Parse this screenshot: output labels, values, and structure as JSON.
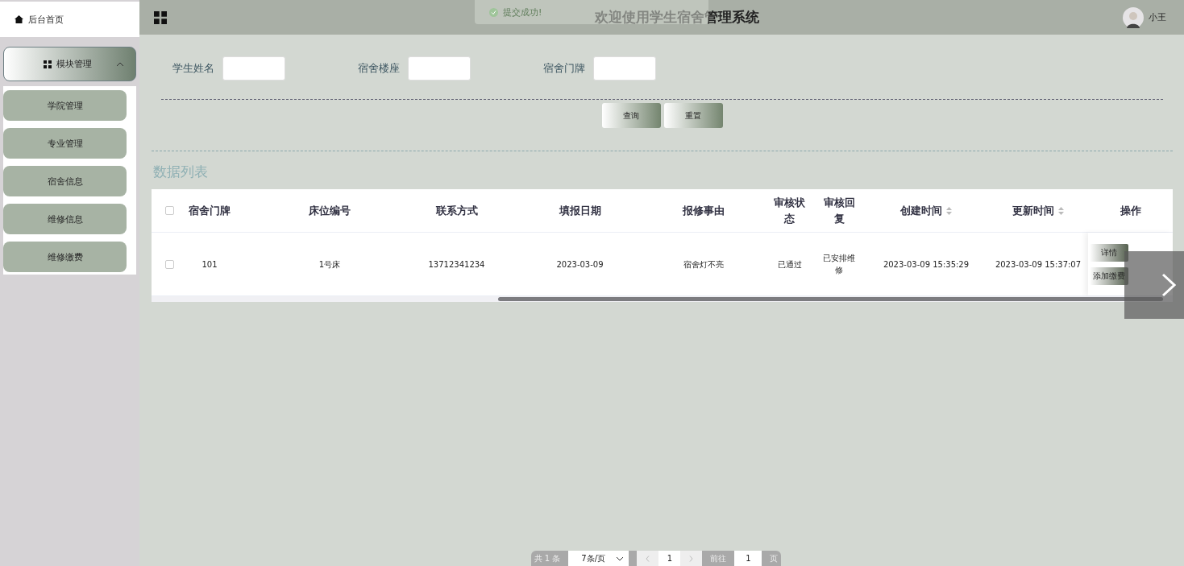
{
  "sidebar": {
    "home": "后台首页",
    "group": {
      "label": "模块管理",
      "expanded": true
    },
    "items": [
      "学院管理",
      "专业管理",
      "宿舍信息",
      "维修信息",
      "维修缴费"
    ]
  },
  "header": {
    "title": "欢迎使用学生宿舍管理系统",
    "user": "小王"
  },
  "toast": {
    "text": "提交成功!"
  },
  "search": {
    "fields": [
      {
        "label": "学生姓名"
      },
      {
        "label": "宿舍楼座"
      },
      {
        "label": "宿舍门牌"
      }
    ],
    "buttons": [
      "查询",
      "重置"
    ]
  },
  "list_title": "数据列表",
  "table": {
    "all_checked": false,
    "columns": [
      {
        "label": "宿舍门牌",
        "sortable": false
      },
      {
        "label": "床位编号",
        "sortable": false
      },
      {
        "label": "联系方式",
        "sortable": false
      },
      {
        "label": "填报日期",
        "sortable": false
      },
      {
        "label": "报修事由",
        "sortable": false
      },
      {
        "label": "审核状态",
        "sortable": false
      },
      {
        "label": "审核回复",
        "sortable": false
      },
      {
        "label": "创建时间",
        "sortable": true
      },
      {
        "label": "更新时间",
        "sortable": true
      },
      {
        "label": "操作",
        "sortable": false
      }
    ],
    "rows": [
      {
        "checked": false,
        "cells": [
          "101",
          "1号床",
          "13712341234",
          "2023-03-09",
          "宿舍灯不亮",
          "已通过",
          "已安排维修",
          "2023-03-09 15:35:29",
          "2023-03-09 15:37:07"
        ],
        "actions": [
          "详情",
          "添加缴费"
        ]
      }
    ]
  },
  "pagination": {
    "total": "共 1 条",
    "page_size": "7条/页",
    "page": "1",
    "goto_label": "前往",
    "goto_value": "1",
    "goto_suffix": "页"
  }
}
